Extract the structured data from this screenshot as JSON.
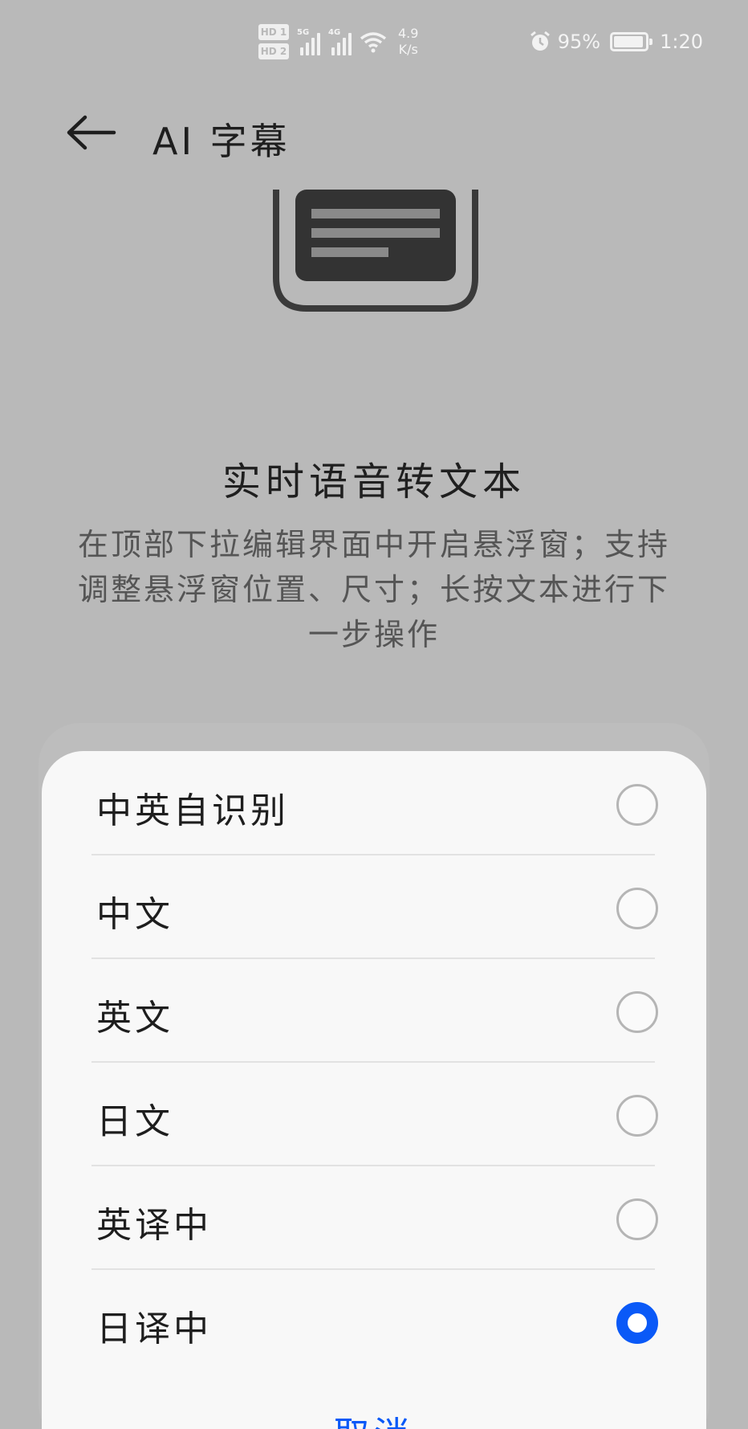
{
  "status_bar": {
    "hd1": "HD 1",
    "hd2": "HD 2",
    "net1": "5G",
    "net2": "4G",
    "speed_value": "4.9",
    "speed_unit": "K/s",
    "battery": "95%",
    "battery_level": 0.95,
    "time": "1:20",
    "icons": [
      "signal-icon",
      "wifi-icon",
      "alarm-icon",
      "battery-icon"
    ]
  },
  "header": {
    "title": "AI 字幕",
    "back_icon": "back-arrow-icon"
  },
  "feature": {
    "title": "实时语音转文本",
    "description": "在顶部下拉编辑界面中开启悬浮窗；支持调整悬浮窗位置、尺寸；长按文本进行下一步操作"
  },
  "options": [
    {
      "label": "中英自识别",
      "selected": false
    },
    {
      "label": "中文",
      "selected": false
    },
    {
      "label": "英文",
      "selected": false
    },
    {
      "label": "日文",
      "selected": false
    },
    {
      "label": "英译中",
      "selected": false
    },
    {
      "label": "日译中",
      "selected": true
    }
  ],
  "cancel_label": "取消",
  "colors": {
    "accent": "#0a59f7",
    "background": "#b9b9b9",
    "sheet": "#f8f8f8"
  }
}
